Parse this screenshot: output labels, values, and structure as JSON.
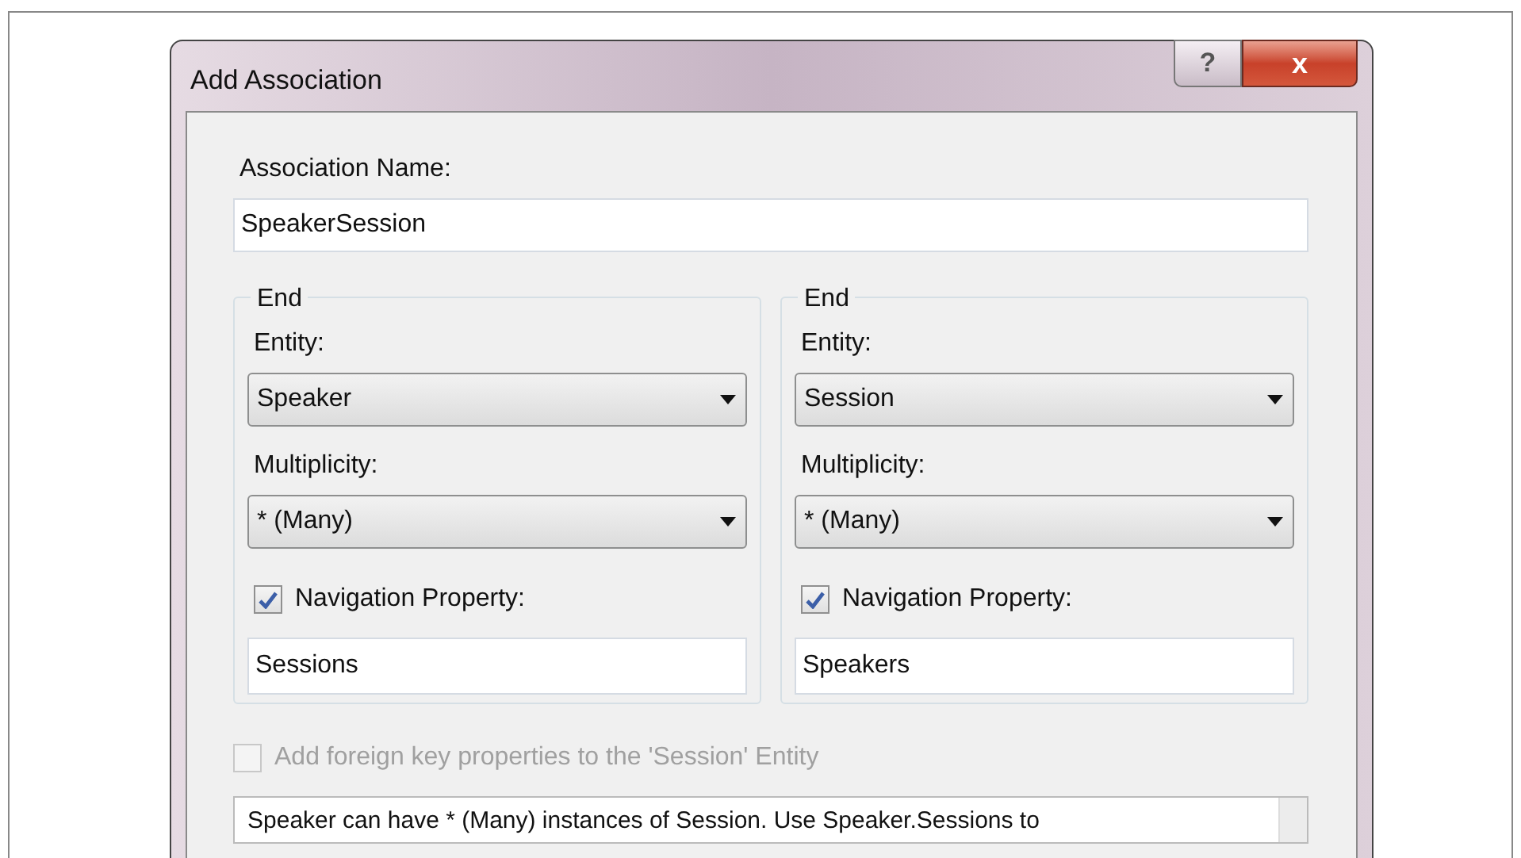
{
  "window": {
    "title": "Add Association",
    "buttons": [
      {
        "kind": "help",
        "label": "?"
      },
      {
        "kind": "close",
        "label": "x"
      }
    ]
  },
  "association_name": {
    "label": "Association Name:",
    "value": "SpeakerSession"
  },
  "ends": [
    {
      "title": "End",
      "entity_label": "Entity:",
      "entity": "Speaker",
      "multiplicity_label": "Multiplicity:",
      "multiplicity": "* (Many)",
      "navigation": {
        "label": "Navigation Property:",
        "checked": true,
        "value": "Sessions"
      }
    },
    {
      "title": "End",
      "entity_label": "Entity:",
      "entity": "Session",
      "multiplicity_label": "Multiplicity:",
      "multiplicity": "* (Many)",
      "navigation": {
        "label": "Navigation Property:",
        "checked": true,
        "value": "Speakers"
      }
    }
  ],
  "foreign_key": {
    "label": "Add foreign key properties to the 'Session' Entity",
    "checked": false,
    "disabled": true
  },
  "description": "Speaker can have * (Many) instances of Session. Use Speaker.Sessions to"
}
